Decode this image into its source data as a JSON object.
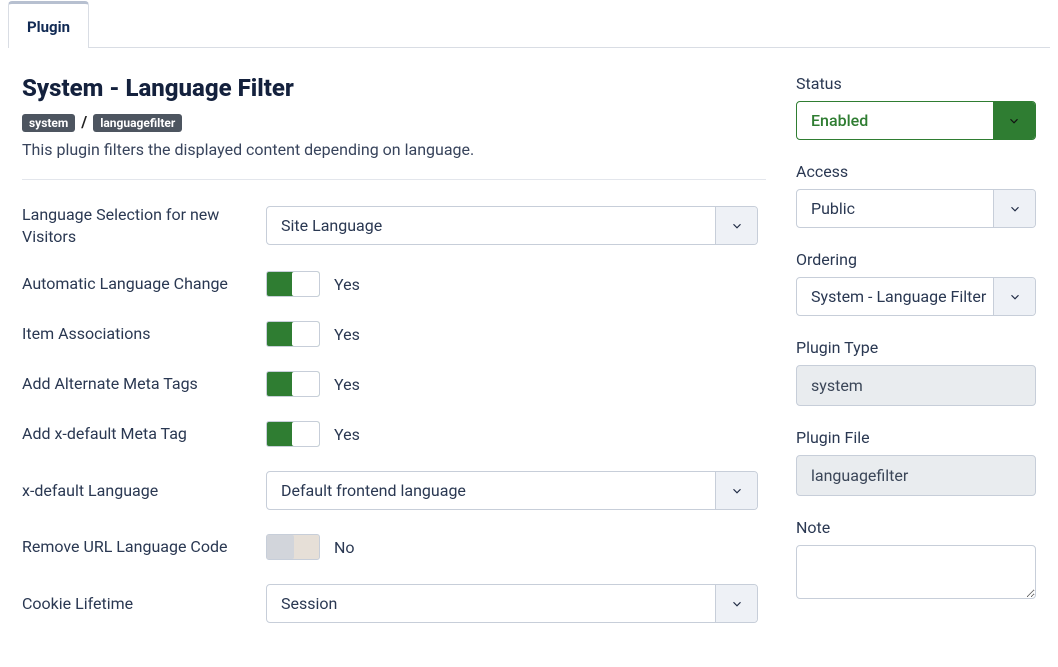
{
  "tab": {
    "label": "Plugin"
  },
  "header": {
    "title": "System - Language Filter",
    "chip1": "system",
    "chip2": "languagefilter",
    "description": "This plugin filters the displayed content depending on language."
  },
  "fields": {
    "lang_selection": {
      "label": "Language Selection for new Visitors",
      "value": "Site Language"
    },
    "auto_change": {
      "label": "Automatic Language Change",
      "value": "Yes",
      "on": true
    },
    "item_assoc": {
      "label": "Item Associations",
      "value": "Yes",
      "on": true
    },
    "alt_meta": {
      "label": "Add Alternate Meta Tags",
      "value": "Yes",
      "on": true
    },
    "xdefault_meta": {
      "label": "Add x-default Meta Tag",
      "value": "Yes",
      "on": true
    },
    "xdefault_lang": {
      "label": "x-default Language",
      "value": "Default frontend language"
    },
    "remove_url": {
      "label": "Remove URL Language Code",
      "value": "No",
      "on": false
    },
    "cookie": {
      "label": "Cookie Lifetime",
      "value": "Session"
    }
  },
  "side": {
    "status": {
      "label": "Status",
      "value": "Enabled"
    },
    "access": {
      "label": "Access",
      "value": "Public"
    },
    "ordering": {
      "label": "Ordering",
      "value": "System - Language Filter"
    },
    "plugin_type": {
      "label": "Plugin Type",
      "value": "system"
    },
    "plugin_file": {
      "label": "Plugin File",
      "value": "languagefilter"
    },
    "note": {
      "label": "Note",
      "value": ""
    }
  }
}
